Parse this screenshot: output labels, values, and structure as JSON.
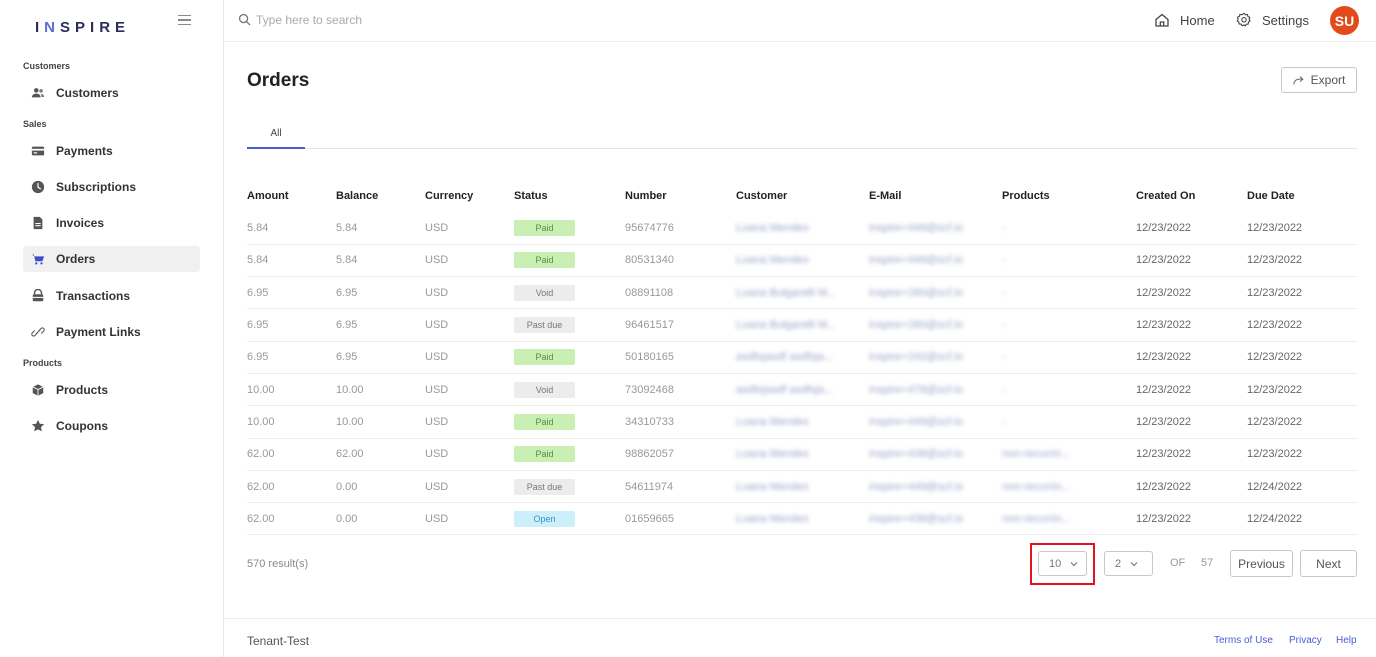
{
  "app": {
    "logo_pre": "I",
    "logo_n": "N",
    "logo_post": "SPIRE"
  },
  "sidebar": {
    "sections": [
      "Customers",
      "Sales",
      "Products"
    ],
    "items": [
      {
        "label": "Customers",
        "icon": "users-icon"
      },
      {
        "label": "Payments",
        "icon": "card-icon"
      },
      {
        "label": "Subscriptions",
        "icon": "clock-icon"
      },
      {
        "label": "Invoices",
        "icon": "file-icon"
      },
      {
        "label": "Orders",
        "icon": "cart-icon",
        "active": true
      },
      {
        "label": "Transactions",
        "icon": "wallet-icon"
      },
      {
        "label": "Payment Links",
        "icon": "link-icon"
      },
      {
        "label": "Products",
        "icon": "box-icon"
      },
      {
        "label": "Coupons",
        "icon": "star-icon"
      }
    ]
  },
  "topbar": {
    "search_placeholder": "Type here to search",
    "home_label": "Home",
    "settings_label": "Settings",
    "avatar_initials": "SU"
  },
  "main": {
    "title": "Orders",
    "export_label": "Export",
    "tabs": [
      {
        "label": "All",
        "active": true
      }
    ]
  },
  "table": {
    "columns": [
      "Amount",
      "Balance",
      "Currency",
      "Status",
      "Number",
      "Customer",
      "E-Mail",
      "Products",
      "Created On",
      "Due Date"
    ],
    "rows": [
      {
        "amount": "5.84",
        "balance": "5.84",
        "currency": "USD",
        "status": "Paid",
        "number": "95674776",
        "customer": "Luana Mendes",
        "email": "inspire+449@scf.io",
        "products": "-",
        "created": "12/23/2022",
        "due": "12/23/2022"
      },
      {
        "amount": "5.84",
        "balance": "5.84",
        "currency": "USD",
        "status": "Paid",
        "number": "80531340",
        "customer": "Luana Mendes",
        "email": "inspire+449@scf.io",
        "products": "-",
        "created": "12/23/2022",
        "due": "12/23/2022"
      },
      {
        "amount": "6.95",
        "balance": "6.95",
        "currency": "USD",
        "status": "Void",
        "number": "08891108",
        "customer": "Luana Bulgarelli M...",
        "email": "inspire+280@scf.io",
        "products": "-",
        "created": "12/23/2022",
        "due": "12/23/2022"
      },
      {
        "amount": "6.95",
        "balance": "6.95",
        "currency": "USD",
        "status": "Past due",
        "number": "96461517",
        "customer": "Luana Bulgarelli M...",
        "email": "inspire+280@scf.io",
        "products": "-",
        "created": "12/23/2022",
        "due": "12/23/2022"
      },
      {
        "amount": "6.95",
        "balance": "6.95",
        "currency": "USD",
        "status": "Paid",
        "number": "50180165",
        "customer": "asdfojasdf asdfsja...",
        "email": "inspire+242@scf.io",
        "products": "-",
        "created": "12/23/2022",
        "due": "12/23/2022"
      },
      {
        "amount": "10.00",
        "balance": "10.00",
        "currency": "USD",
        "status": "Void",
        "number": "73092468",
        "customer": "asdfojasdf asdfsja...",
        "email": "inspire+478@scf.io",
        "products": "-",
        "created": "12/23/2022",
        "due": "12/23/2022"
      },
      {
        "amount": "10.00",
        "balance": "10.00",
        "currency": "USD",
        "status": "Paid",
        "number": "34310733",
        "customer": "Luana Mendes",
        "email": "inspire+449@scf.io",
        "products": "-",
        "created": "12/23/2022",
        "due": "12/23/2022"
      },
      {
        "amount": "62.00",
        "balance": "62.00",
        "currency": "USD",
        "status": "Paid",
        "number": "98862057",
        "customer": "Luana Mendes",
        "email": "inspire+438@scf.io",
        "products": "non-recurrin...",
        "created": "12/23/2022",
        "due": "12/23/2022"
      },
      {
        "amount": "62.00",
        "balance": "0.00",
        "currency": "USD",
        "status": "Past due",
        "number": "54611974",
        "customer": "Luana Mendes",
        "email": "inspire+449@scf.io",
        "products": "non-recurrin...",
        "created": "12/23/2022",
        "due": "12/24/2022"
      },
      {
        "amount": "62.00",
        "balance": "0.00",
        "currency": "USD",
        "status": "Open",
        "number": "01659665",
        "customer": "Luana Mendes",
        "email": "inspire+438@scf.io",
        "products": "non-recurrin...",
        "created": "12/23/2022",
        "due": "12/24/2022"
      }
    ]
  },
  "pagination": {
    "results_label": "570 result(s)",
    "page_size": "10",
    "current_page": "2",
    "of_label": "OF",
    "total_pages": "57",
    "previous_label": "Previous",
    "next_label": "Next"
  },
  "footer": {
    "tenant": "Tenant-Test",
    "terms_label": "Terms of Use",
    "privacy_label": "Privacy",
    "help_label": "Help"
  },
  "colors": {
    "accent": "#4a5bd6",
    "avatar": "#e34a1b",
    "highlight": "#e0141e",
    "paid_bg": "#c9efb4",
    "open_bg": "#cdeefb"
  }
}
